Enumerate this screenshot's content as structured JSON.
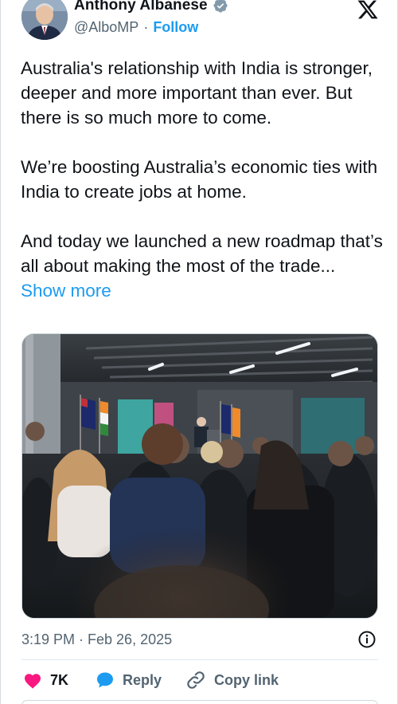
{
  "author": {
    "display_name": "Anthony Albanese",
    "handle": "@AlboMP",
    "separator": "·",
    "follow_label": "Follow",
    "verified": true
  },
  "brand": {
    "logo": "x-logo-icon"
  },
  "tweet": {
    "paragraphs": [
      "Australia's relationship with India is stronger, deeper and more important than ever. But there is so much more to come.",
      "We’re boosting Australia’s economic ties with India to create jobs at home."
    ],
    "last_paragraph": "And today we launched a new roadmap that’s all about making the most of the trade...",
    "show_more_label": "Show more",
    "media_alt": "photo"
  },
  "meta": {
    "timestamp": "3:19 PM · Feb 26, 2025"
  },
  "actions": {
    "like_count": "7K",
    "reply_label": "Reply",
    "copy_link_label": "Copy link"
  },
  "colors": {
    "accent": "#1d9bf0",
    "like": "#f91880",
    "text": "#0f1419",
    "secondary": "#536471"
  }
}
